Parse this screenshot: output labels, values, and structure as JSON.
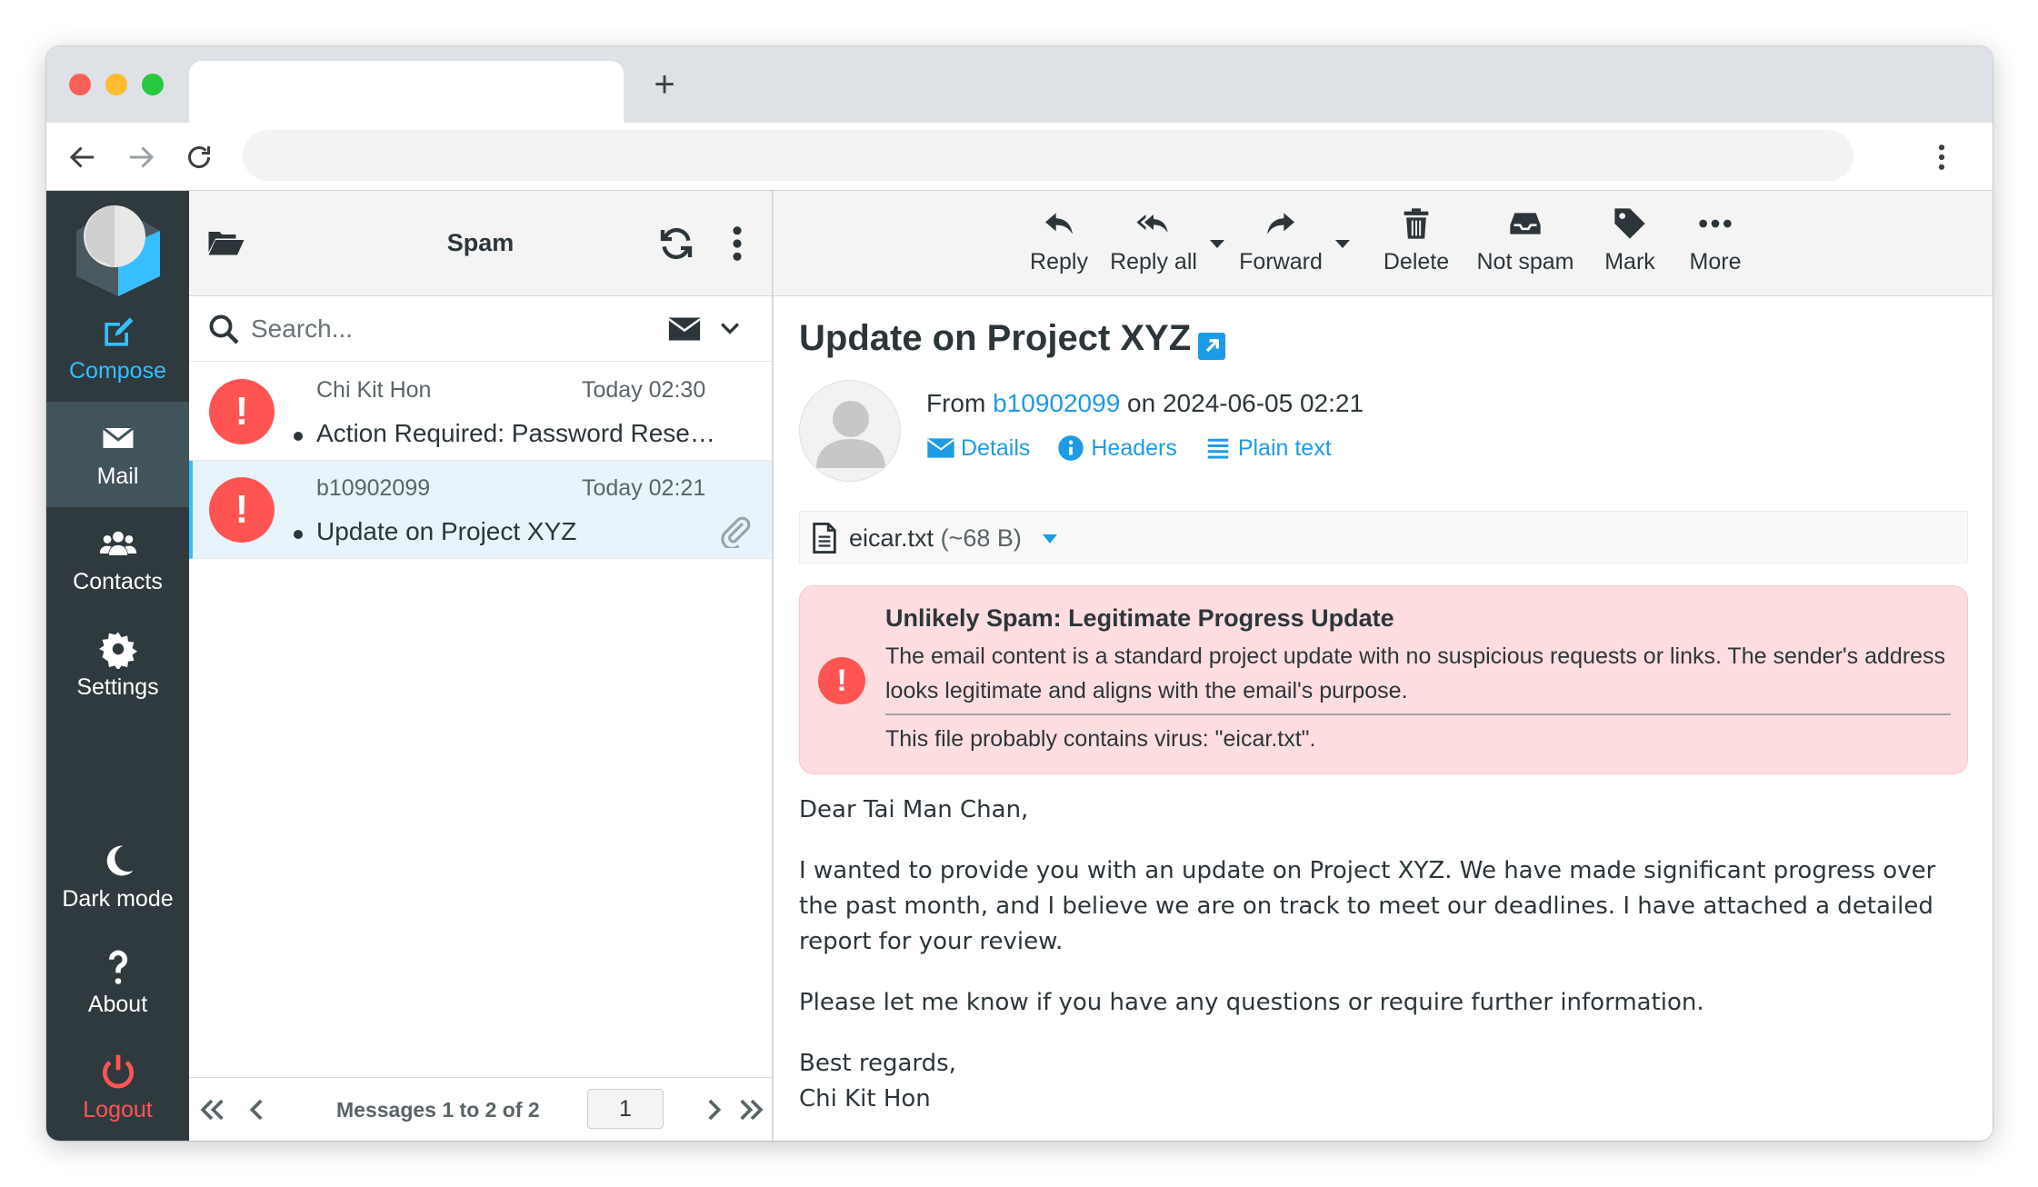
{
  "browser": {
    "new_tab": "+"
  },
  "sidebar": {
    "items": [
      {
        "label": "Compose"
      },
      {
        "label": "Mail"
      },
      {
        "label": "Contacts"
      },
      {
        "label": "Settings"
      },
      {
        "label": "Dark mode"
      },
      {
        "label": "About"
      },
      {
        "label": "Logout"
      }
    ]
  },
  "list": {
    "folder": "Spam",
    "search_placeholder": "Search...",
    "messages": [
      {
        "from": "Chi Kit Hon",
        "date": "Today 02:30",
        "subject": "Action Required: Password Reset Request"
      },
      {
        "from": "b10902099",
        "date": "Today 02:21",
        "subject": "Update on Project XYZ"
      }
    ],
    "footer": {
      "count_text": "Messages 1 to 2 of 2",
      "page": "1"
    }
  },
  "toolbar": {
    "reply": "Reply",
    "reply_all": "Reply all",
    "forward": "Forward",
    "delete": "Delete",
    "not_spam": "Not spam",
    "mark": "Mark",
    "more": "More"
  },
  "message": {
    "subject": "Update on Project XYZ",
    "from_prefix": "From",
    "sender": "b10902099",
    "date_text": "on 2024-06-05 02:21",
    "links": {
      "details": "Details",
      "headers": "Headers",
      "plain": "Plain text"
    },
    "attachment": {
      "name": "eicar.txt",
      "size": "(~68 B)"
    },
    "alert": {
      "title": "Unlikely Spam: Legitimate Progress Update",
      "body": "The email content is a standard project update with no suspicious requests or links. The sender's address looks legitimate and aligns with the email's purpose.",
      "virus": "This file probably contains virus: \"eicar.txt\"."
    },
    "body": {
      "greeting": "Dear Tai Man Chan,",
      "p1": "I wanted to provide you with an update on Project XYZ. We have made significant progress over the past month, and I believe we are on track to meet our deadlines. I have attached a detailed report for your review.",
      "p2": "Please let me know if you have any questions or require further information.",
      "closing": "Best regards,",
      "signature": "Chi Kit Hon"
    }
  },
  "colors": {
    "accent": "#1e9be6",
    "danger": "#ff5552",
    "sidebar": "#2f3a3f"
  }
}
